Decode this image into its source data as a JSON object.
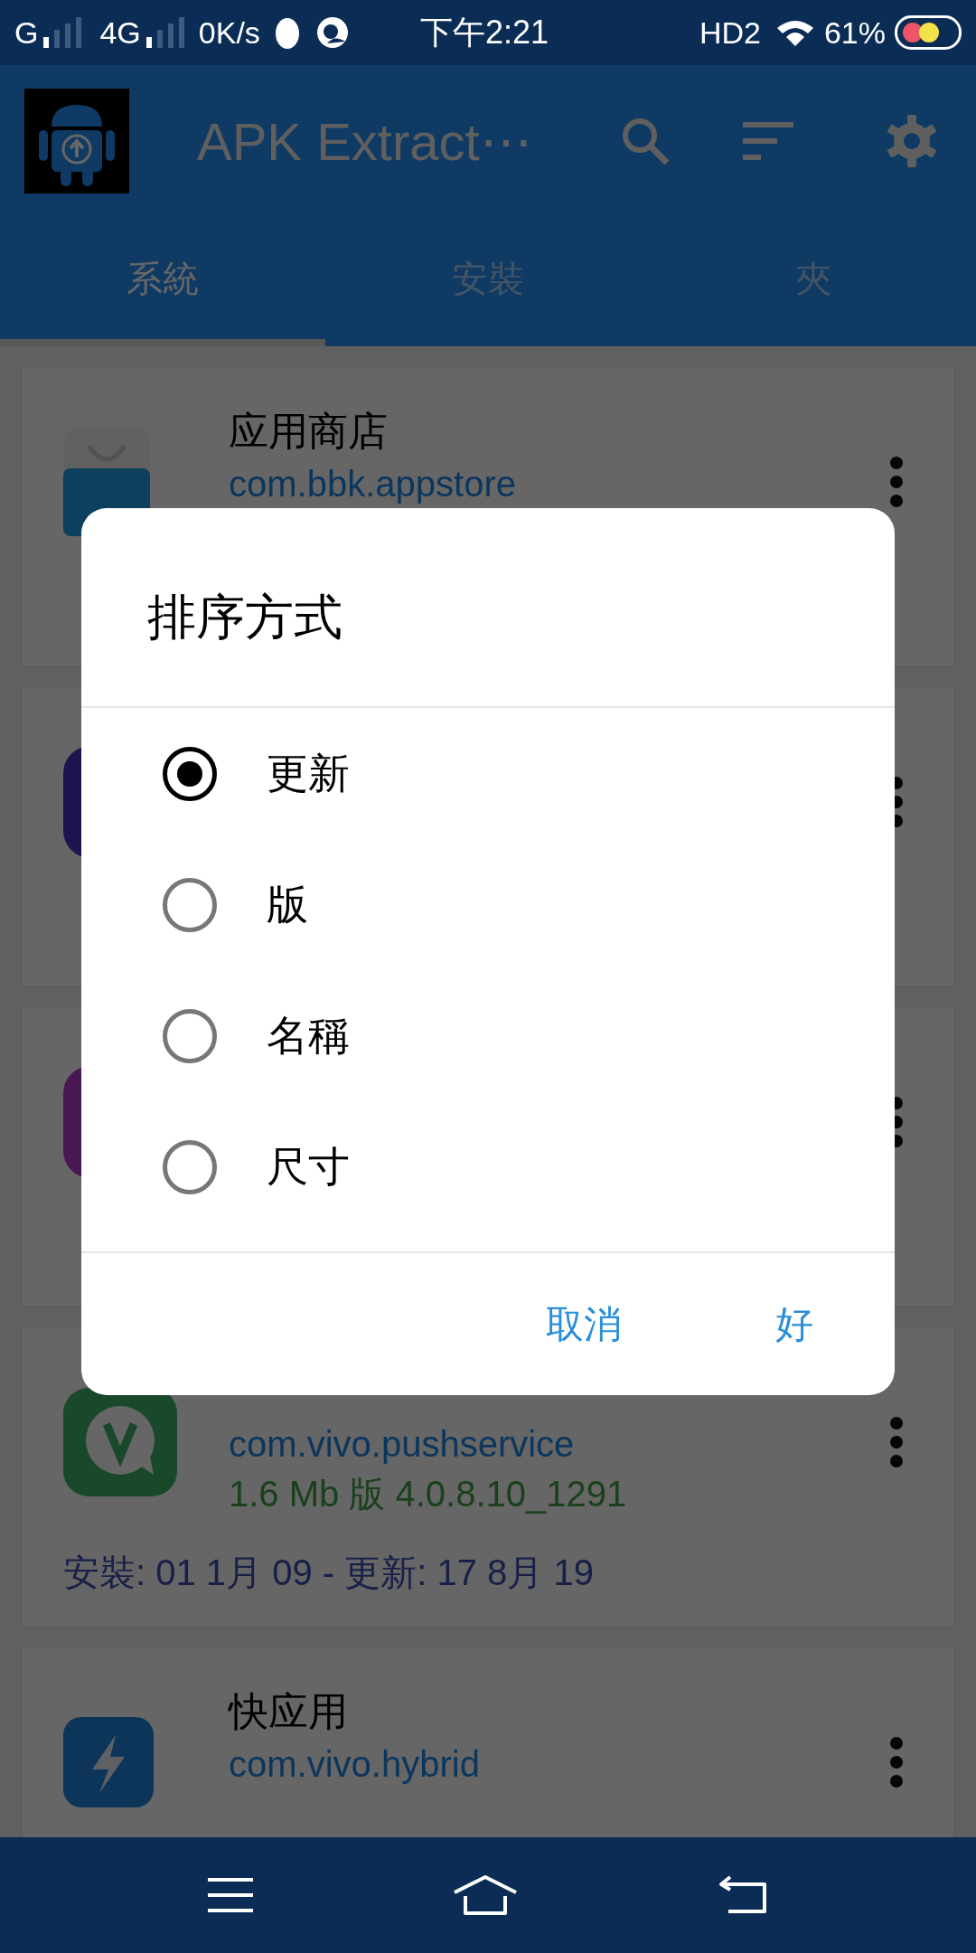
{
  "status_bar": {
    "network_1": "G",
    "network_2": "4G",
    "speed": "0K/s",
    "time": "下午2:21",
    "hd": "HD2",
    "battery": "61%"
  },
  "app_bar": {
    "title": "APK Extract⋯"
  },
  "tabs": [
    {
      "label": "系統",
      "selected": true
    },
    {
      "label": "安裝",
      "selected": false
    },
    {
      "label": "夾",
      "selected": false
    }
  ],
  "apps": [
    {
      "kind": "store",
      "name": "应用商店",
      "package": "com.bbk.appstore"
    },
    {
      "kind": "purple"
    },
    {
      "kind": "magenta"
    },
    {
      "kind": "push",
      "package": "com.vivo.pushservice",
      "size_version": "1.6 Mb 版 4.0.8.10_1291",
      "dates": "安裝: 01 1月 09 - 更新: 17 8月 19"
    },
    {
      "kind": "bolt",
      "name": "快应用",
      "package": "com.vivo.hybrid"
    }
  ],
  "dialog": {
    "title": "排序方式",
    "options": [
      {
        "label": "更新",
        "selected": true
      },
      {
        "label": "版",
        "selected": false
      },
      {
        "label": "名稱",
        "selected": false
      },
      {
        "label": "尺寸",
        "selected": false
      }
    ],
    "buttons": [
      "取消",
      "好"
    ]
  }
}
